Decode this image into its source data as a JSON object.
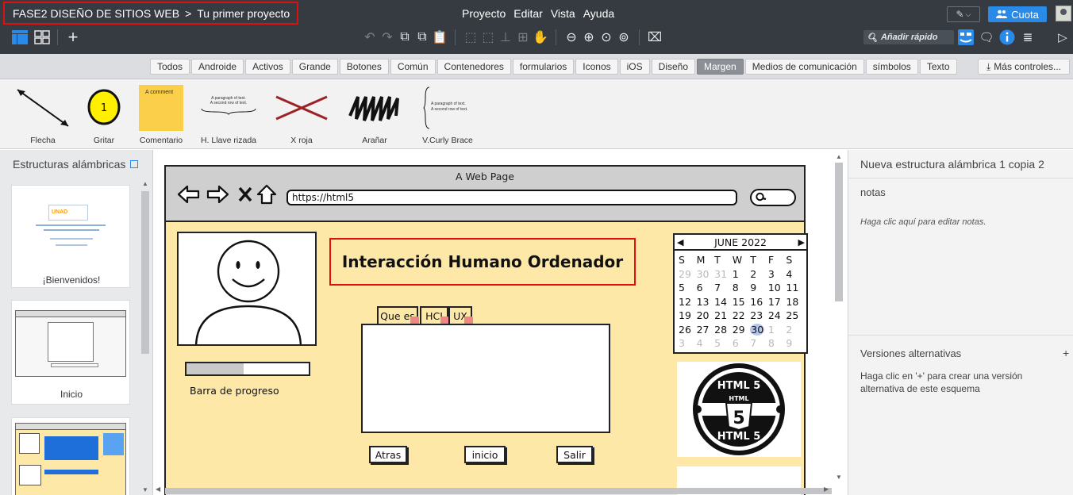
{
  "topbar": {
    "project_title": "FASE2 DISEÑO DE SITIOS WEB",
    "separator": ">",
    "project_name": "Tu primer proyecto",
    "menu": [
      "Proyecto",
      "Editar",
      "Vista",
      "Ayuda"
    ],
    "quota_label": "Cuota",
    "quick_add_placeholder": "Añadir rápido"
  },
  "categories": {
    "items": [
      "Todos",
      "Androide",
      "Activos",
      "Grande",
      "Botones",
      "Común",
      "Contenedores",
      "formularios",
      "Iconos",
      "iOS",
      "Diseño",
      "Margen",
      "Medios de comunicación",
      "símbolos",
      "Texto"
    ],
    "active": "Margen",
    "more_label": "Más controles..."
  },
  "palette": {
    "items": [
      {
        "label": "Flecha"
      },
      {
        "label": "Gritar",
        "badge": "1"
      },
      {
        "label": "Comentario",
        "text": "A comment"
      },
      {
        "label": "H. Llave rizada",
        "line1": "A paragraph of text.",
        "line2": "A second row of text."
      },
      {
        "label": "X roja"
      },
      {
        "label": "Arañar"
      },
      {
        "label": "V.Curly Brace",
        "line1": "A paragraph of text.",
        "line2": "A second row of text."
      }
    ]
  },
  "left_panel": {
    "title": "Estructuras alámbricas",
    "slides": [
      {
        "label": "¡Bienvenidos!"
      },
      {
        "label": "Inicio"
      }
    ]
  },
  "wireframe": {
    "page_title": "A Web Page",
    "url": "https://html5",
    "heading": "Interacción Humano Ordenador",
    "progress_label": "Barra de progreso",
    "progress_value": 0.47,
    "tabs": [
      "Que es",
      "HCI",
      "UX"
    ],
    "buttons": [
      "Atras",
      "inicio",
      "Salir"
    ],
    "calendar": {
      "month": "JUNE 2022",
      "weekdays": [
        "S",
        "M",
        "T",
        "W",
        "T",
        "F",
        "S"
      ],
      "days": [
        {
          "d": "29",
          "m": true
        },
        {
          "d": "30",
          "m": true
        },
        {
          "d": "31",
          "m": true
        },
        {
          "d": "1"
        },
        {
          "d": "2"
        },
        {
          "d": "3"
        },
        {
          "d": "4"
        },
        {
          "d": "5"
        },
        {
          "d": "6"
        },
        {
          "d": "7"
        },
        {
          "d": "8"
        },
        {
          "d": "9"
        },
        {
          "d": "10"
        },
        {
          "d": "11"
        },
        {
          "d": "12"
        },
        {
          "d": "13"
        },
        {
          "d": "14"
        },
        {
          "d": "15"
        },
        {
          "d": "16"
        },
        {
          "d": "17"
        },
        {
          "d": "18"
        },
        {
          "d": "19"
        },
        {
          "d": "20"
        },
        {
          "d": "21"
        },
        {
          "d": "22"
        },
        {
          "d": "23"
        },
        {
          "d": "24"
        },
        {
          "d": "25"
        },
        {
          "d": "26"
        },
        {
          "d": "27"
        },
        {
          "d": "28"
        },
        {
          "d": "29"
        },
        {
          "d": "30",
          "sel": true
        },
        {
          "d": "1",
          "m": true
        },
        {
          "d": "2",
          "m": true
        },
        {
          "d": "3",
          "m": true
        },
        {
          "d": "4",
          "m": true
        },
        {
          "d": "5",
          "m": true
        },
        {
          "d": "6",
          "m": true
        },
        {
          "d": "7",
          "m": true
        },
        {
          "d": "8",
          "m": true
        },
        {
          "d": "9",
          "m": true
        }
      ]
    },
    "logo_text": "HTML 5",
    "logo_center": "HTML",
    "logo_number": "5"
  },
  "right_panel": {
    "title": "Nueva estructura alámbrica 1 copia 2",
    "notes_label": "notas",
    "notes_hint": "Haga clic aquí para editar notas.",
    "versions_label": "Versiones alternativas",
    "versions_add": "+",
    "versions_hint": "Haga clic en '+' para crear una versión alternativa de este esquema"
  },
  "colors": {
    "topbar": "#363b42",
    "accent": "#2a8ae8",
    "highlight_red": "#e01010",
    "wireframe_bg": "#fde8a8"
  }
}
